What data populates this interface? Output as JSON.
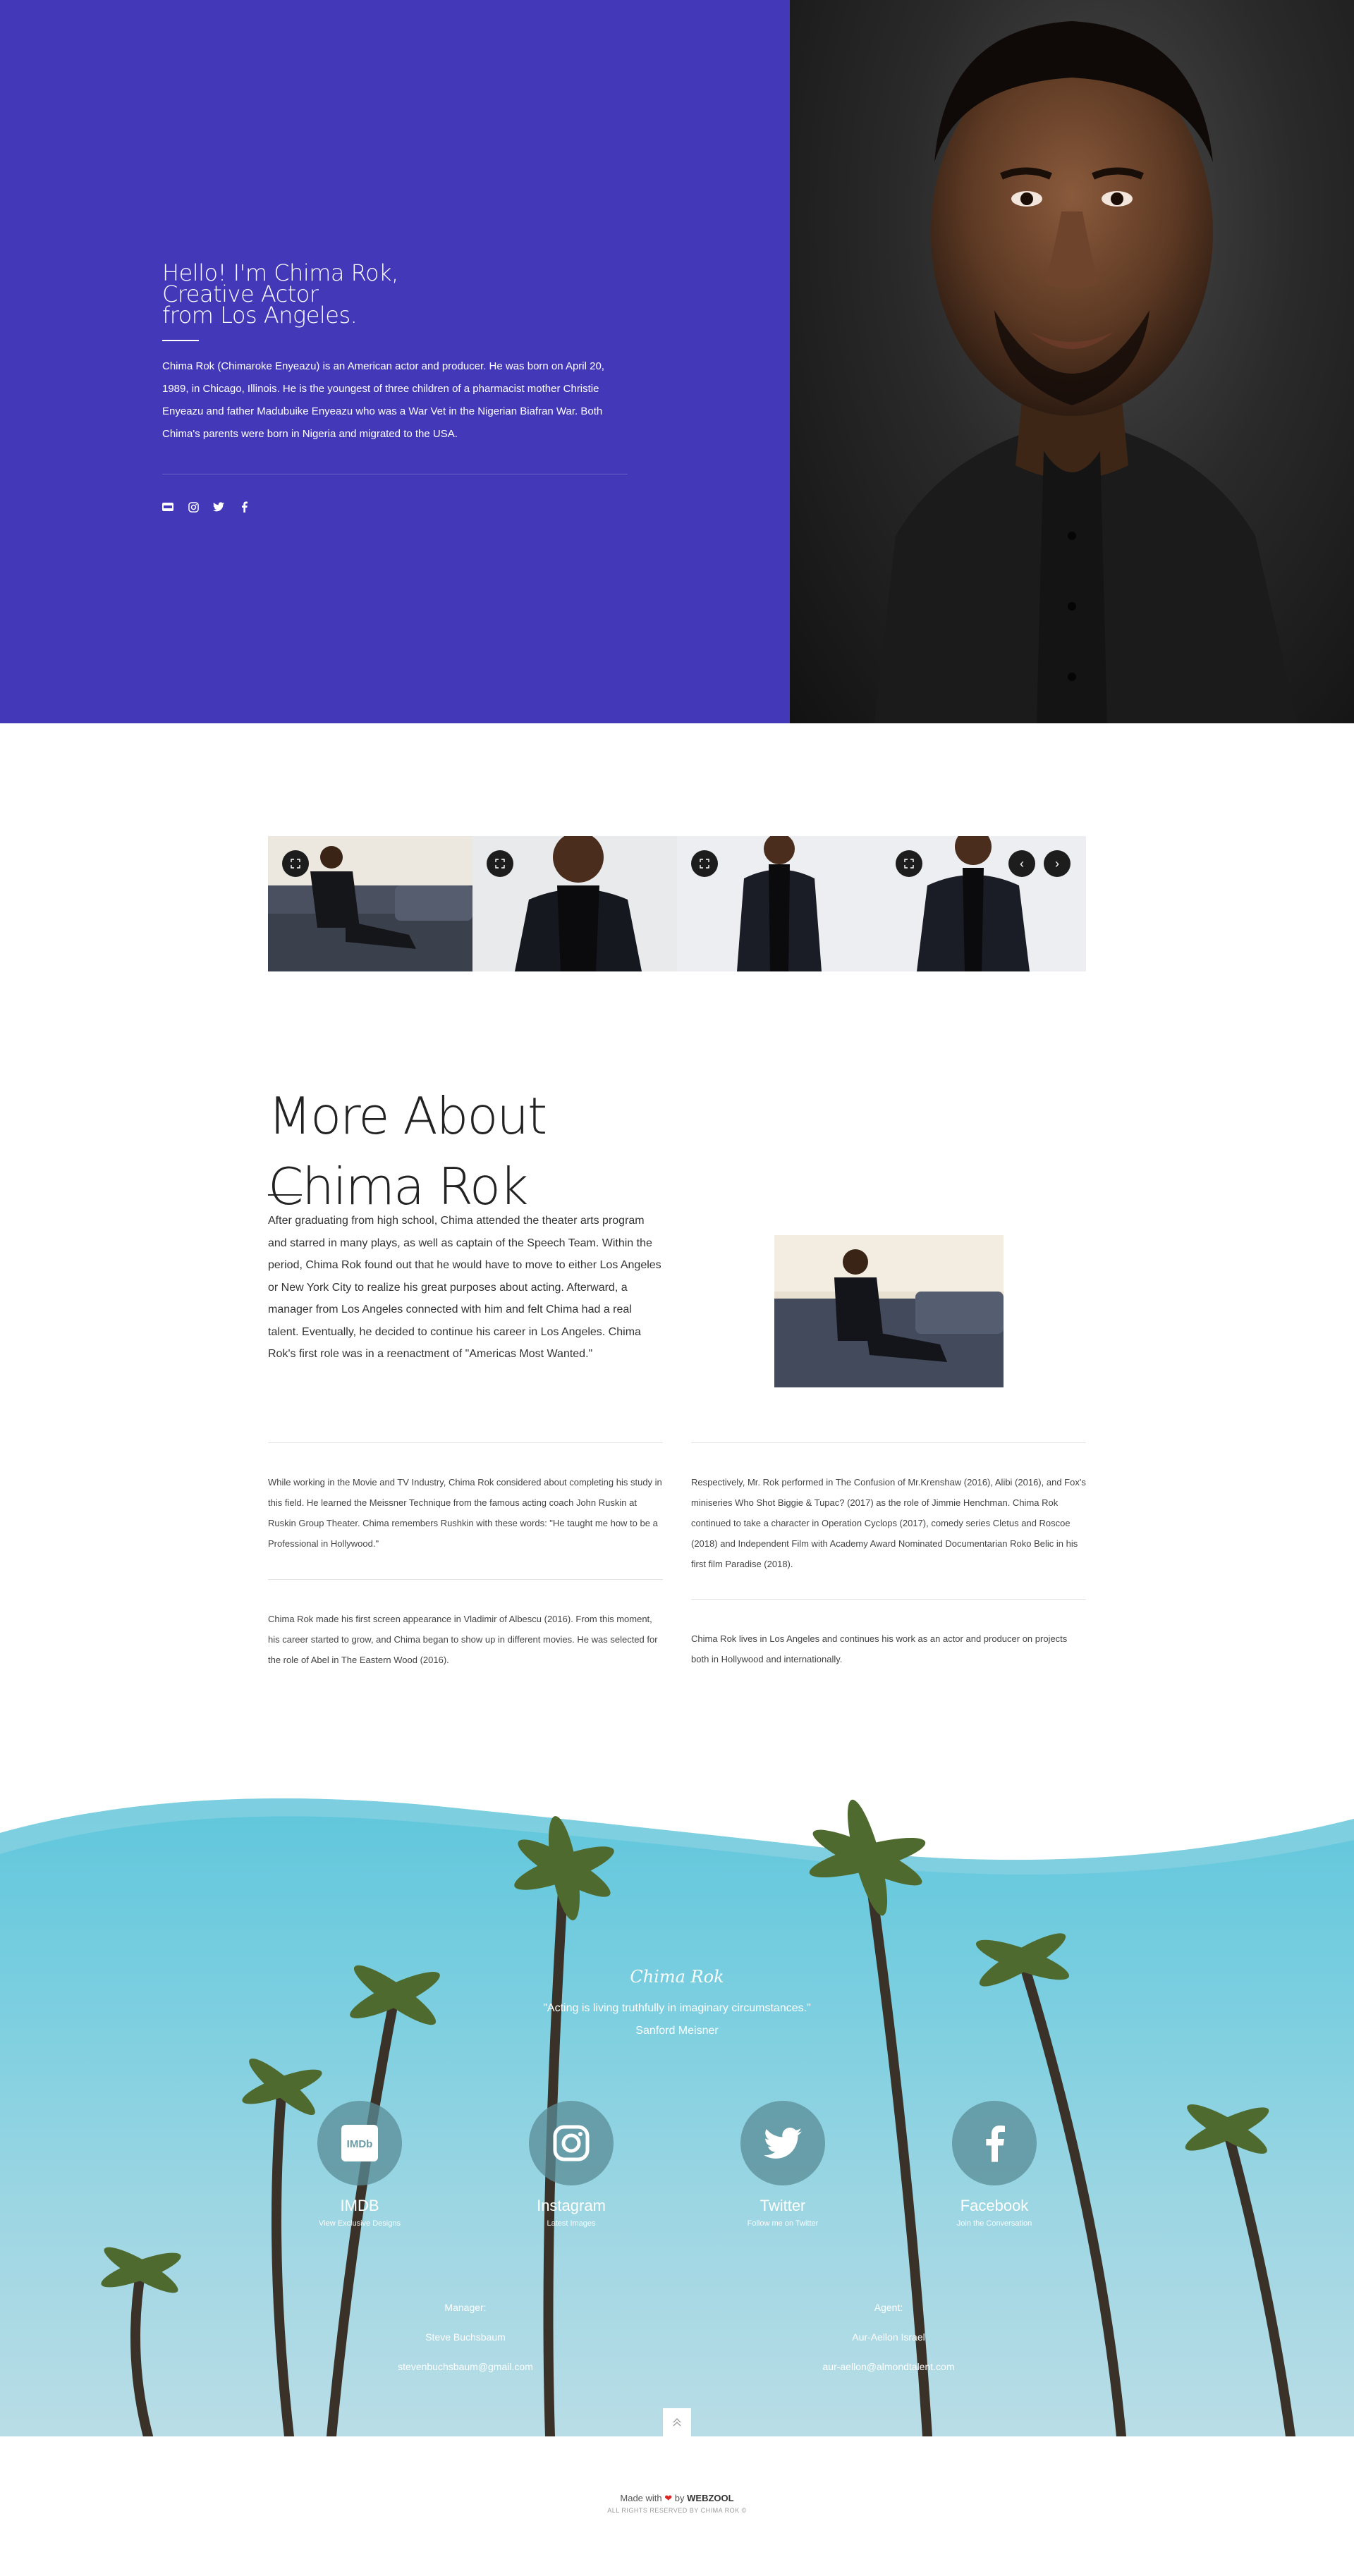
{
  "hero": {
    "title_lines": [
      "Hello! I'm Chima Rok,",
      "Creative Actor",
      "from Los Angeles."
    ],
    "bio": "Chima Rok (Chimaroke Enyeazu) is an American actor and producer. He was born on April 20, 1989, in Chicago, Illinois. He is the youngest of three children of a pharmacist mother Christie Enyeazu and father Madubuike Enyeazu who was a War Vet in the Nigerian Biafran War. Both Chima's parents were born in Nigeria and migrated to the USA.",
    "socials": [
      "imdb-icon",
      "instagram-icon",
      "twitter-icon",
      "facebook-icon"
    ],
    "bg_color": "#4338b8"
  },
  "gallery": {
    "items": [
      "photo-1",
      "photo-2",
      "photo-3",
      "photo-4"
    ],
    "prev": "‹",
    "next": "›"
  },
  "about": {
    "title_line1": "More About",
    "title_line2": "Chima Rok",
    "paragraph": "After graduating from high school, Chima attended the theater arts program and starred in many plays, as well as captain of the Speech Team. Within the period, Chima Rok found out that he would have to move to either Los Angeles or New York City to realize his great purposes about acting. Afterward, a manager from Los Angeles connected with him and felt Chima had a real talent. Eventually, he decided to continue his career in Los Angeles. Chima Rok's first role was in a reenactment of \"Americas Most Wanted.\"",
    "col1_p1": "While working in the Movie and TV Industry, Chima Rok considered about completing his study in this field. He learned the Meissner Technique from the famous acting coach John Ruskin at Ruskin Group Theater. Chima remembers Rushkin with these words: \"He taught me how to be a Professional in Hollywood.\"",
    "col1_p2": "Chima Rok made his first screen appearance in Vladimir of Albescu (2016). From this moment, his career started to grow, and Chima began to show up in different movies. He was selected for the role of Abel in The Eastern Wood (2016).",
    "col2_p1": "Respectively, Mr. Rok performed in The Confusion of Mr.Krenshaw (2016), Alibi (2016), and Fox's miniseries Who Shot Biggie & Tupac? (2017) as the role of Jimmie Henchman. Chima Rok continued to take a character in Operation Cyclops (2017), comedy series Cletus and Roscoe (2018) and Independent Film with Academy Award Nominated Documentarian Roko Belic in his first film Paradise (2018).",
    "col2_p2": "Chima Rok lives in Los Angeles and continues his work as an actor and producer on projects both in Hollywood and internationally."
  },
  "footer": {
    "signature": "Chima Rok",
    "quote": "\"Acting is living truthfully in imaginary circumstances.\"",
    "quote_author": "Sanford Meisner",
    "socials": [
      {
        "title": "IMDB",
        "sub": "View Exclusive Designs",
        "icon": "imdb-icon"
      },
      {
        "title": "Instagram",
        "sub": "Latest Images",
        "icon": "instagram-icon"
      },
      {
        "title": "Twitter",
        "sub": "Follow me on Twitter",
        "icon": "twitter-icon"
      },
      {
        "title": "Facebook",
        "sub": "Join the Conversation",
        "icon": "facebook-icon"
      }
    ],
    "manager_label": "Manager:",
    "manager_name": "Steve Buchsbaum",
    "manager_email": "stevenbuchsbaum@gmail.com",
    "agent_label": "Agent:",
    "agent_name": "Aur-Aellon Israel",
    "agent_email": "aur-aellon@almondtalent.com"
  },
  "bottom": {
    "made_prefix": "Made with",
    "made_by": "by",
    "brand": "WEBZOOL",
    "rights": "ALL RIGHTS RESERVED BY CHIMA ROK ©"
  }
}
